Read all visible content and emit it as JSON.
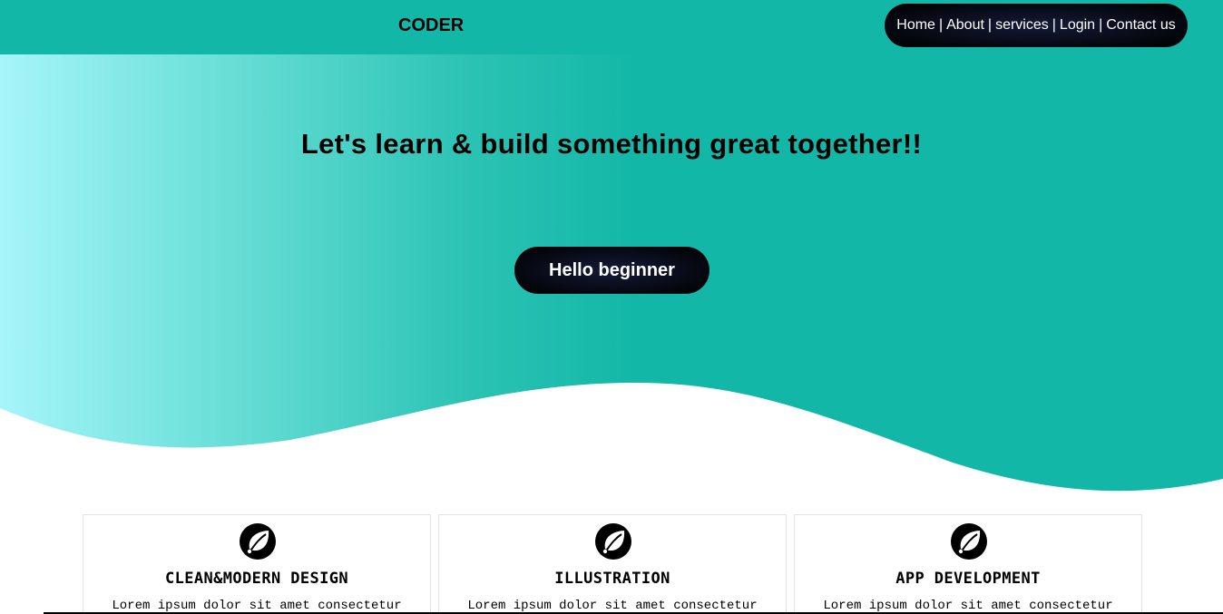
{
  "header": {
    "brand": "CODER",
    "nav": [
      {
        "label": "Home"
      },
      {
        "label": "About"
      },
      {
        "label": "services"
      },
      {
        "label": "Login"
      },
      {
        "label": "Contact us"
      }
    ],
    "separator": "|"
  },
  "hero": {
    "title": "Let's learn & build something great together!!",
    "cta_label": "Hello beginner"
  },
  "cards": [
    {
      "icon": "leaf-icon",
      "title": "CLEAN&MODERN DESIGN",
      "text": "Lorem ipsum dolor sit amet consectetur"
    },
    {
      "icon": "leaf-icon",
      "title": "ILLUSTRATION",
      "text": "Lorem ipsum dolor sit amet consectetur"
    },
    {
      "icon": "leaf-icon",
      "title": "APP DEVELOPMENT",
      "text": "Lorem ipsum dolor sit amet consectetur"
    }
  ],
  "colors": {
    "accent": "#13b7a7",
    "gradient_start": "#a6f5fa",
    "button_dark": "#05070f"
  }
}
